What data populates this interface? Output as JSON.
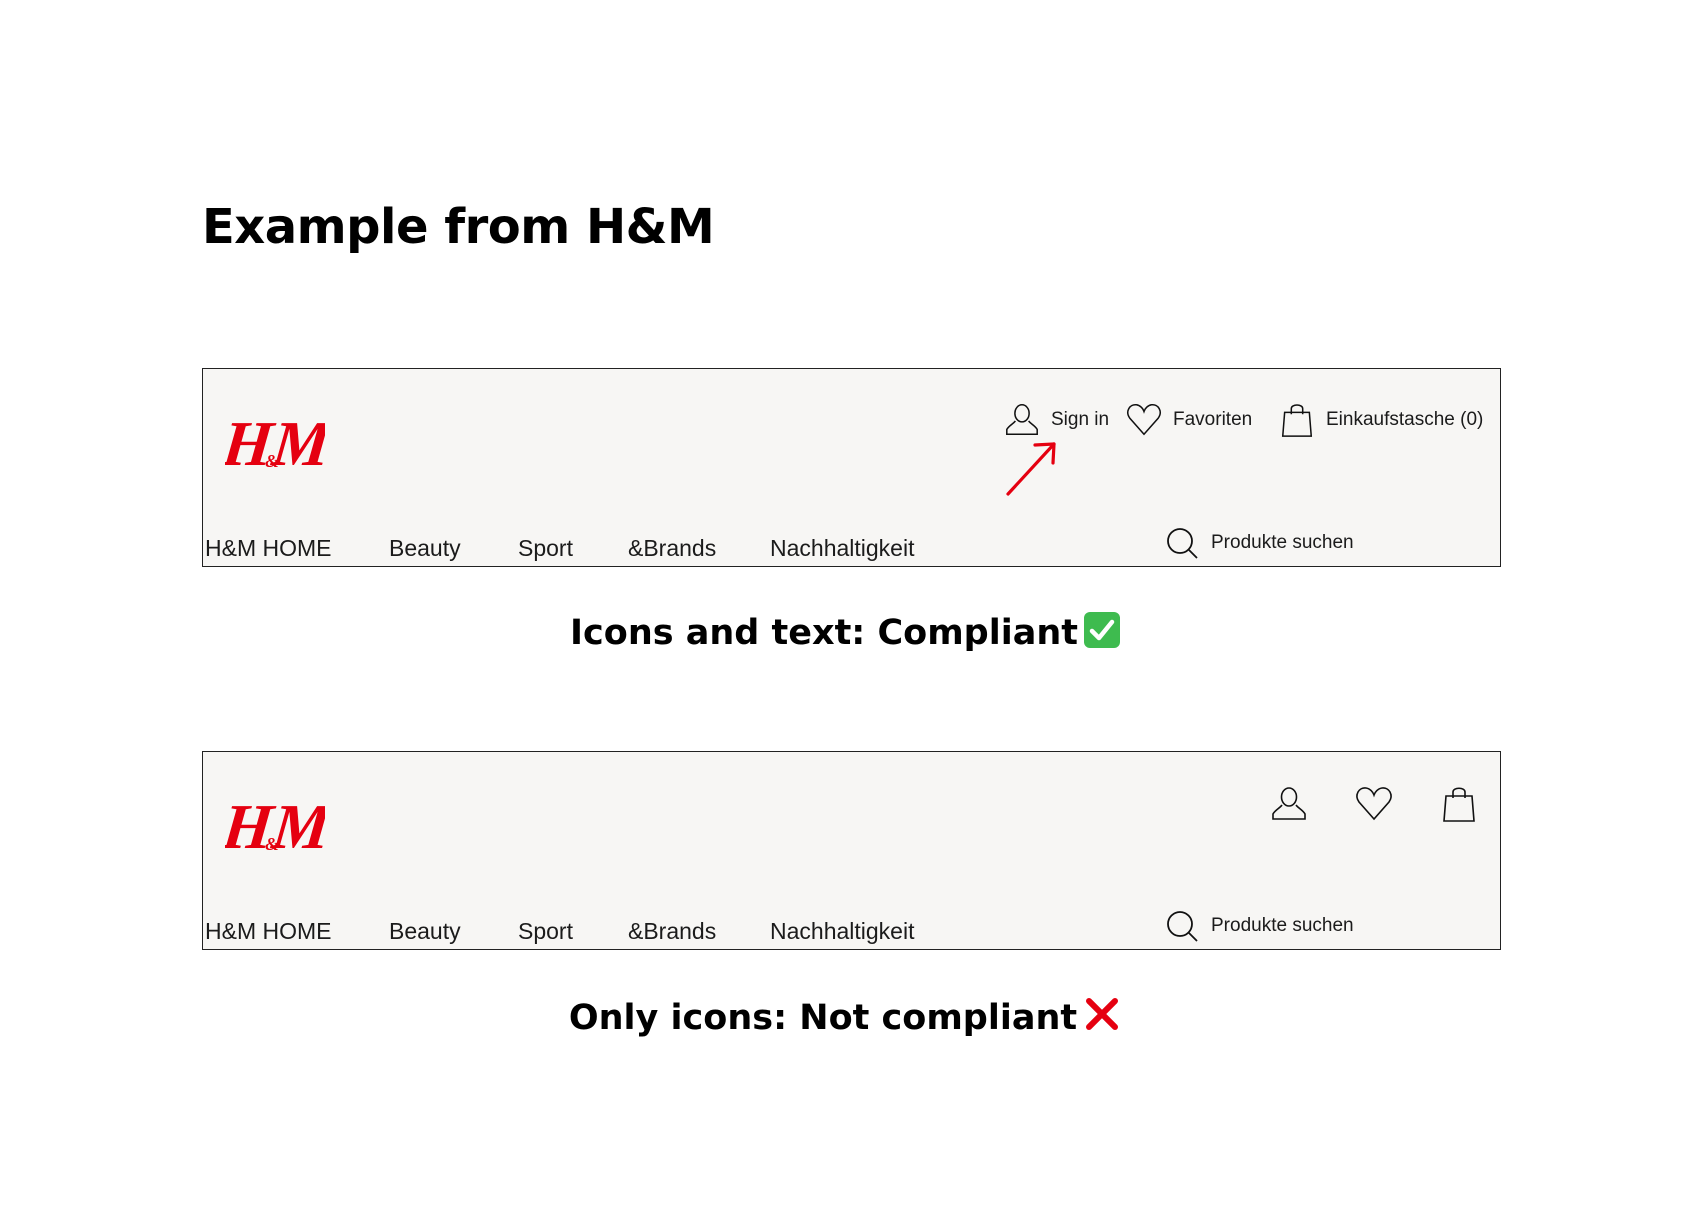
{
  "page_title": "Example from H&M",
  "brand": {
    "logo_text": "H&M",
    "logo_color": "#e50010"
  },
  "nav": [
    "H&M HOME",
    "Beauty",
    "Sport",
    "&Brands",
    "Nachhaltigkeit"
  ],
  "search_placeholder": "Produkte suchen",
  "compliant_example": {
    "sign_in": "Sign in",
    "favorites": "Favoriten",
    "bag": "Einkaufstasche (0)",
    "caption": "Icons and text: Compliant",
    "status_icon": "check-mark-emoji"
  },
  "noncompliant_example": {
    "icons": [
      "user-icon",
      "heart-icon",
      "shopping-bag-icon"
    ],
    "caption": "Only icons: Not compliant",
    "status_icon": "cross-mark-emoji"
  },
  "colors": {
    "accent_red": "#e50010",
    "check_green": "#3ebb4f",
    "header_bg": "#f7f6f4"
  }
}
